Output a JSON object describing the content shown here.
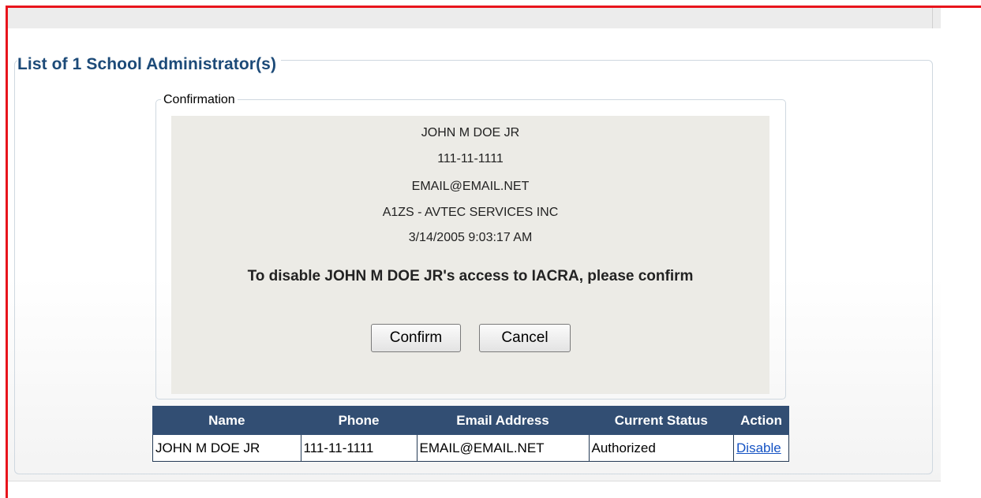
{
  "section": {
    "title": "List of 1 School Administrator(s)"
  },
  "confirmation": {
    "legend": "Confirmation",
    "name": "JOHN M DOE JR",
    "phone": "111-11-1111",
    "email": "EMAIL@EMAIL.NET",
    "organization": "A1ZS - AVTEC SERVICES INC",
    "timestamp": "3/14/2005 9:03:17 AM",
    "message": "To disable JOHN M DOE JR's access to IACRA, please confirm",
    "confirm_label": "Confirm",
    "cancel_label": "Cancel"
  },
  "table": {
    "headers": [
      "Name",
      "Phone",
      "Email Address",
      "Current Status",
      "Action"
    ],
    "rows": [
      {
        "name": "JOHN M DOE JR",
        "phone": "111-11-1111",
        "email": "EMAIL@EMAIL.NET",
        "status": "Authorized",
        "action": "Disable"
      }
    ]
  },
  "colors": {
    "title": "#1c4a78",
    "header_bg": "#324e73",
    "confirm_bg": "#ecebe6",
    "link": "#1553c4",
    "frame_red": "#e8141c"
  }
}
